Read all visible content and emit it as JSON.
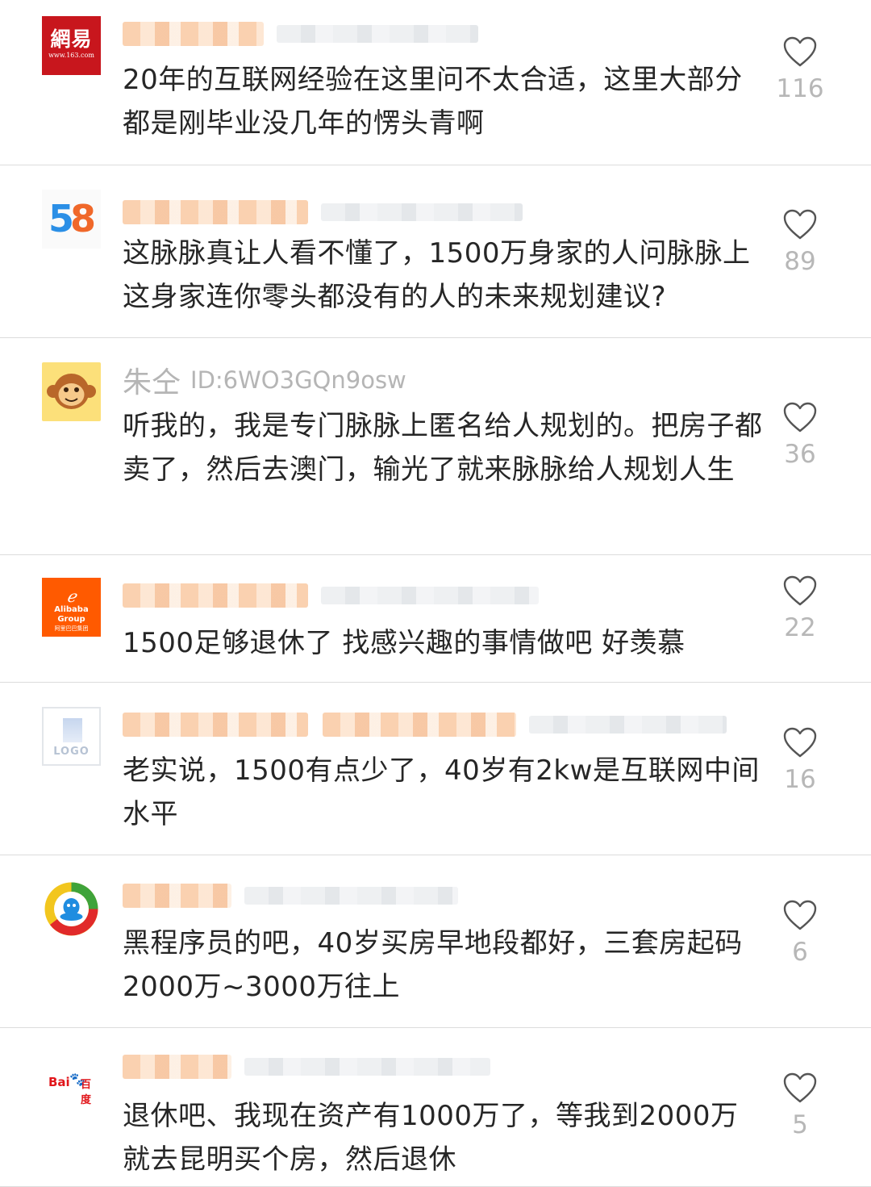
{
  "colors": {
    "divider": "#dcdcdc",
    "text": "#262626",
    "muted": "#b7b7b7",
    "heart_stroke": "#555555"
  },
  "comments": [
    {
      "logo": {
        "name": "netease-logo",
        "text_main": "網易",
        "text_small": "www.163.com"
      },
      "text": "20年的互联网经验在这里问不太合适，这里大部分都是刚毕业没几年的愣头青啊",
      "likes": "116",
      "heart_icon": "heart-outline-icon"
    },
    {
      "logo": {
        "name": "58-logo",
        "digit_five": "5",
        "digit_eight": "8"
      },
      "text": "这脉脉真让人看不懂了，1500万身家的人问脉脉上这身家连你零头都没有的人的未来规划建议?",
      "likes": "89",
      "heart_icon": "heart-outline-icon"
    },
    {
      "logo": {
        "name": "monkey-avatar-icon"
      },
      "username": "朱仝",
      "userid": "ID:6WO3GQn9osw",
      "text": "听我的，我是专门脉脉上匿名给人规划的。把房子都卖了，然后去澳门，输光了就来脉脉给人规划人生",
      "likes": "36",
      "heart_icon": "heart-outline-icon"
    },
    {
      "logo": {
        "name": "alibaba-logo",
        "brand": "Alibaba Group",
        "sub": "阿里巴巴集团"
      },
      "text": "1500足够退休了 找感兴趣的事情做吧 好羡慕",
      "likes": "22",
      "heart_icon": "heart-outline-icon"
    },
    {
      "logo": {
        "name": "generic-logo",
        "text": "LOGO"
      },
      "text": "老实说，1500有点少了，40岁有2kw是互联网中间水平",
      "likes": "16",
      "heart_icon": "heart-outline-icon"
    },
    {
      "logo": {
        "name": "tencent-news-logo"
      },
      "text": "黑程序员的吧，40岁买房早地段都好，三套房起码2000万~3000万往上",
      "likes": "6",
      "heart_icon": "heart-outline-icon"
    },
    {
      "logo": {
        "name": "baidu-logo",
        "bai": "Bai",
        "paw": "🐾",
        "cn": "百度"
      },
      "text": "退休吧、我现在资产有1000万了，等我到2000万就去昆明买个房，然后退休",
      "likes": "5",
      "heart_icon": "heart-outline-icon"
    }
  ]
}
